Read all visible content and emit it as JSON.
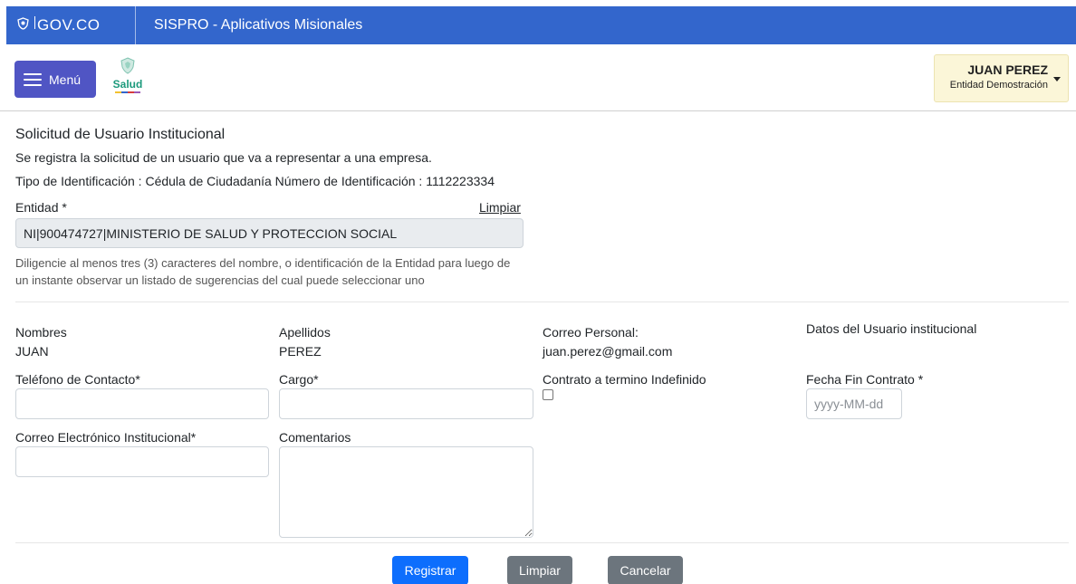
{
  "topbar": {
    "gov_logo_text": "GOV.CO",
    "app_title": "SISPRO - Aplicativos Misionales"
  },
  "header": {
    "menu_label": "Menú",
    "logo_text": "Salud",
    "user": {
      "name": "JUAN PEREZ",
      "entity": "Entidad Demostración"
    }
  },
  "form": {
    "title": "Solicitud de Usuario Institucional",
    "description": "Se registra la solicitud de un usuario que va a representar a una empresa.",
    "identification_line": "Tipo de Identificación : Cédula de Ciudadanía  Número de Identificación : 1112223334",
    "entity_label": "Entidad *",
    "entity_clear_link": "Limpiar",
    "entity_value": "NI|900474727|MINISTERIO DE SALUD Y PROTECCION SOCIAL",
    "entity_hint": "Diligencie al menos tres (3) caracteres del nombre, o identificación de la Entidad para luego de un instante observar un listado de sugerencias del cual puede seleccionar uno",
    "nombres_label": "Nombres",
    "nombres_value": "JUAN",
    "apellidos_label": "Apellidos",
    "apellidos_value": "PEREZ",
    "correo_personal_label": "Correo Personal:",
    "correo_personal_value": "juan.perez@gmail.com",
    "datos_usuario_label": "Datos del Usuario institucional",
    "telefono_label": "Teléfono de Contacto*",
    "cargo_label": "Cargo*",
    "contrato_label": "Contrato a termino Indefinido",
    "contrato_checked": false,
    "fecha_fin_label": "Fecha Fin Contrato *",
    "fecha_fin_placeholder": "yyyy-MM-dd",
    "correo_institucional_label": "Correo Electrónico Institucional*",
    "comentarios_label": "Comentarios"
  },
  "buttons": {
    "registrar": "Registrar",
    "limpiar": "Limpiar",
    "cancelar": "Cancelar"
  },
  "colors": {
    "topbar": "#3366cc",
    "menu_button": "#5055c4",
    "user_box": "#fbf6d8",
    "primary": "#0d6efd",
    "secondary": "#6c757d"
  }
}
